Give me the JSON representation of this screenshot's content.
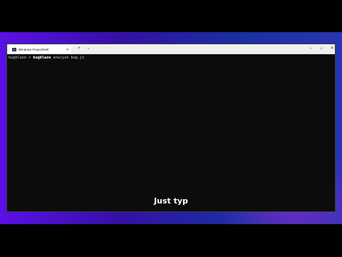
{
  "window": {
    "tab_title": "Windows PowerShell",
    "tab_close": "×",
    "tab_icon": "powershell-icon",
    "new_tab": "+",
    "dropdown": "⌄",
    "minimize": "–",
    "maximize": "□",
    "close": "✕"
  },
  "terminal": {
    "prompt": "bugblaze > ",
    "command": "bugblaze",
    "args": " analyze bug.js"
  },
  "caption": "Just typ",
  "colors": {
    "terminal_bg": "#0c0c0c",
    "gradient_start": "#5a10e6",
    "gradient_end": "#2a35b0"
  }
}
